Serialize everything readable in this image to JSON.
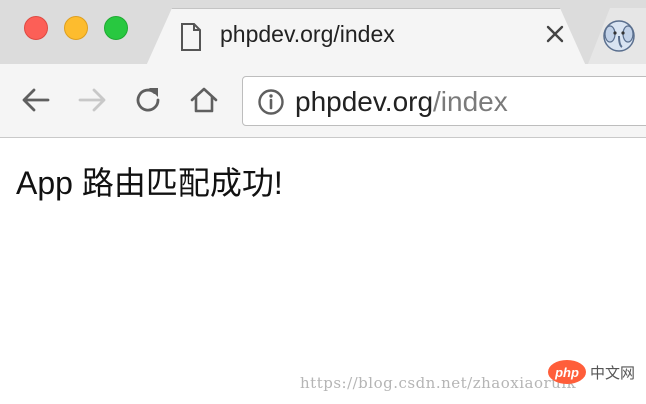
{
  "window": {
    "traffic_lights": {
      "close": "#fc5f57",
      "minimize": "#fdbc2e",
      "maximize": "#28c840"
    }
  },
  "tabs": [
    {
      "title": "phpdev.org/index",
      "icon": "document-icon",
      "active": true
    },
    {
      "title": "",
      "icon": "elephant-icon",
      "active": false
    }
  ],
  "toolbar": {
    "back_icon": "arrow-left-icon",
    "forward_icon": "arrow-right-icon",
    "reload_icon": "reload-icon",
    "home_icon": "home-icon",
    "address": {
      "host": "phpdev.org",
      "path": "/index",
      "icon": "info-icon"
    }
  },
  "page": {
    "message": "App 路由匹配成功!"
  },
  "overlay": {
    "watermark": "https://blog.csdn.net/zhaoxiaoruik",
    "badge": "php",
    "site": "中文网"
  }
}
